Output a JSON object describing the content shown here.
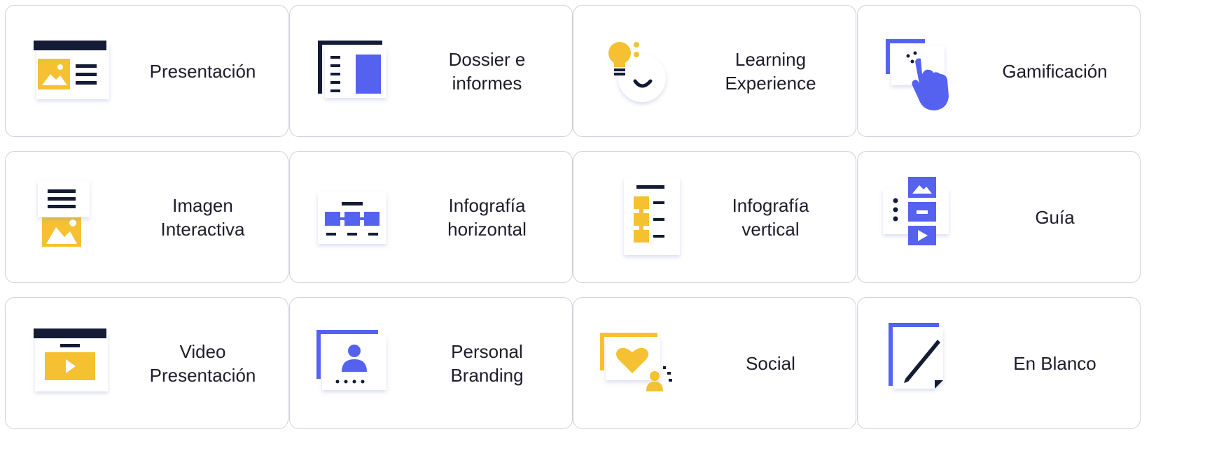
{
  "colors": {
    "navy": "#141b34",
    "yellow": "#f5c132",
    "blue": "#5562f0",
    "card_border": "#cfd1da",
    "text": "#1d1d2b"
  },
  "templates": [
    {
      "label": "Presentación",
      "icon": "presentation-icon"
    },
    {
      "label": "Dossier e\ninformes",
      "icon": "dossier-icon"
    },
    {
      "label": "Learning\nExperience",
      "icon": "learning-experience-icon"
    },
    {
      "label": "Gamificación",
      "icon": "gamification-icon"
    },
    {
      "label": "Imagen\nInteractiva",
      "icon": "interactive-image-icon"
    },
    {
      "label": "Infografía\nhorizontal",
      "icon": "horizontal-infographic-icon"
    },
    {
      "label": "Infografía\nvertical",
      "icon": "vertical-infographic-icon"
    },
    {
      "label": "Guía",
      "icon": "guide-icon"
    },
    {
      "label": "Video\nPresentación",
      "icon": "video-presentation-icon"
    },
    {
      "label": "Personal\nBranding",
      "icon": "personal-branding-icon"
    },
    {
      "label": "Social",
      "icon": "social-icon"
    },
    {
      "label": "En Blanco",
      "icon": "blank-icon"
    }
  ]
}
